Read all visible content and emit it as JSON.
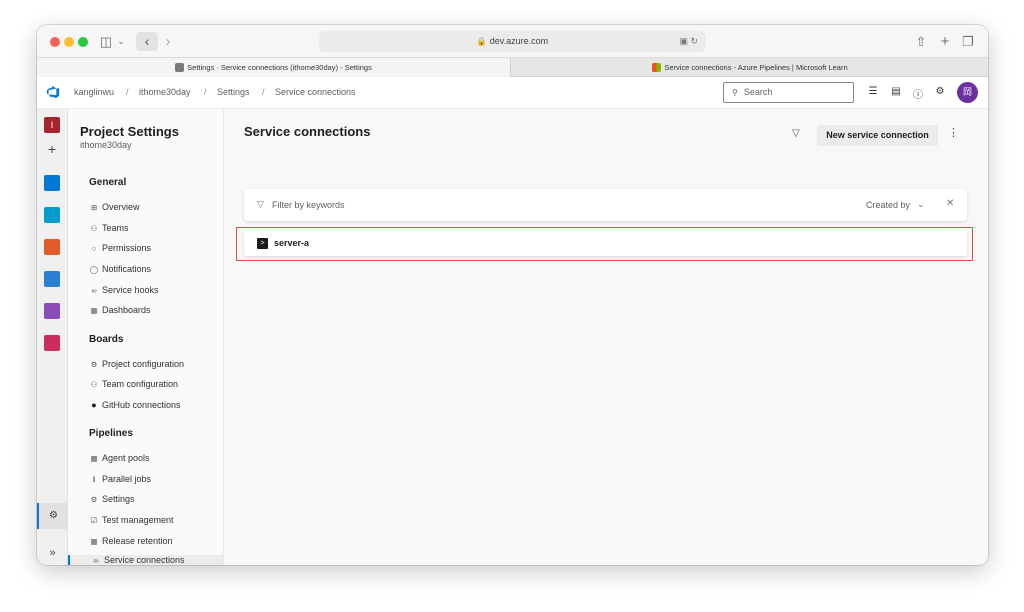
{
  "browser": {
    "url": "dev.azure.com",
    "tabs": [
      {
        "label": "Settings · Service connections (ithome30day) - Settings",
        "active": true
      },
      {
        "label": "Service connections - Azure Pipelines | Microsoft Learn",
        "active": false
      }
    ]
  },
  "header": {
    "breadcrumb": [
      "kanglinwu",
      "ithome30day",
      "Settings",
      "Service connections"
    ],
    "search_placeholder": "Search",
    "avatar_initial": "岡"
  },
  "sidebar": {
    "title": "Project Settings",
    "project": "ithome30day",
    "sections": [
      {
        "label": "General",
        "items": [
          {
            "icon": "grid-icon",
            "label": "Overview"
          },
          {
            "icon": "people-icon",
            "label": "Teams"
          },
          {
            "icon": "lock-icon",
            "label": "Permissions"
          },
          {
            "icon": "chat-icon",
            "label": "Notifications"
          },
          {
            "icon": "link-icon",
            "label": "Service hooks"
          },
          {
            "icon": "dashboard-icon",
            "label": "Dashboards"
          }
        ]
      },
      {
        "label": "Boards",
        "items": [
          {
            "icon": "gear-icon",
            "label": "Project configuration"
          },
          {
            "icon": "team-config-icon",
            "label": "Team configuration"
          },
          {
            "icon": "github-icon",
            "label": "GitHub connections"
          }
        ]
      },
      {
        "label": "Pipelines",
        "items": [
          {
            "icon": "agent-pools-icon",
            "label": "Agent pools"
          },
          {
            "icon": "parallel-jobs-icon",
            "label": "Parallel jobs"
          },
          {
            "icon": "gear-icon",
            "label": "Settings"
          },
          {
            "icon": "test-management-icon",
            "label": "Test management"
          },
          {
            "icon": "release-retention-icon",
            "label": "Release retention"
          },
          {
            "icon": "service-connections-icon",
            "label": "Service connections"
          }
        ]
      }
    ]
  },
  "main": {
    "title": "Service connections",
    "new_button": "New service connection",
    "filter_placeholder": "Filter by keywords",
    "sort_label": "Created by",
    "connections": [
      {
        "name": "server-a",
        "icon": "terminal-icon"
      }
    ]
  },
  "colors": {
    "accent": "#0078d4",
    "highlight": "#e04a3a",
    "avatar": "#6b2fa0"
  }
}
